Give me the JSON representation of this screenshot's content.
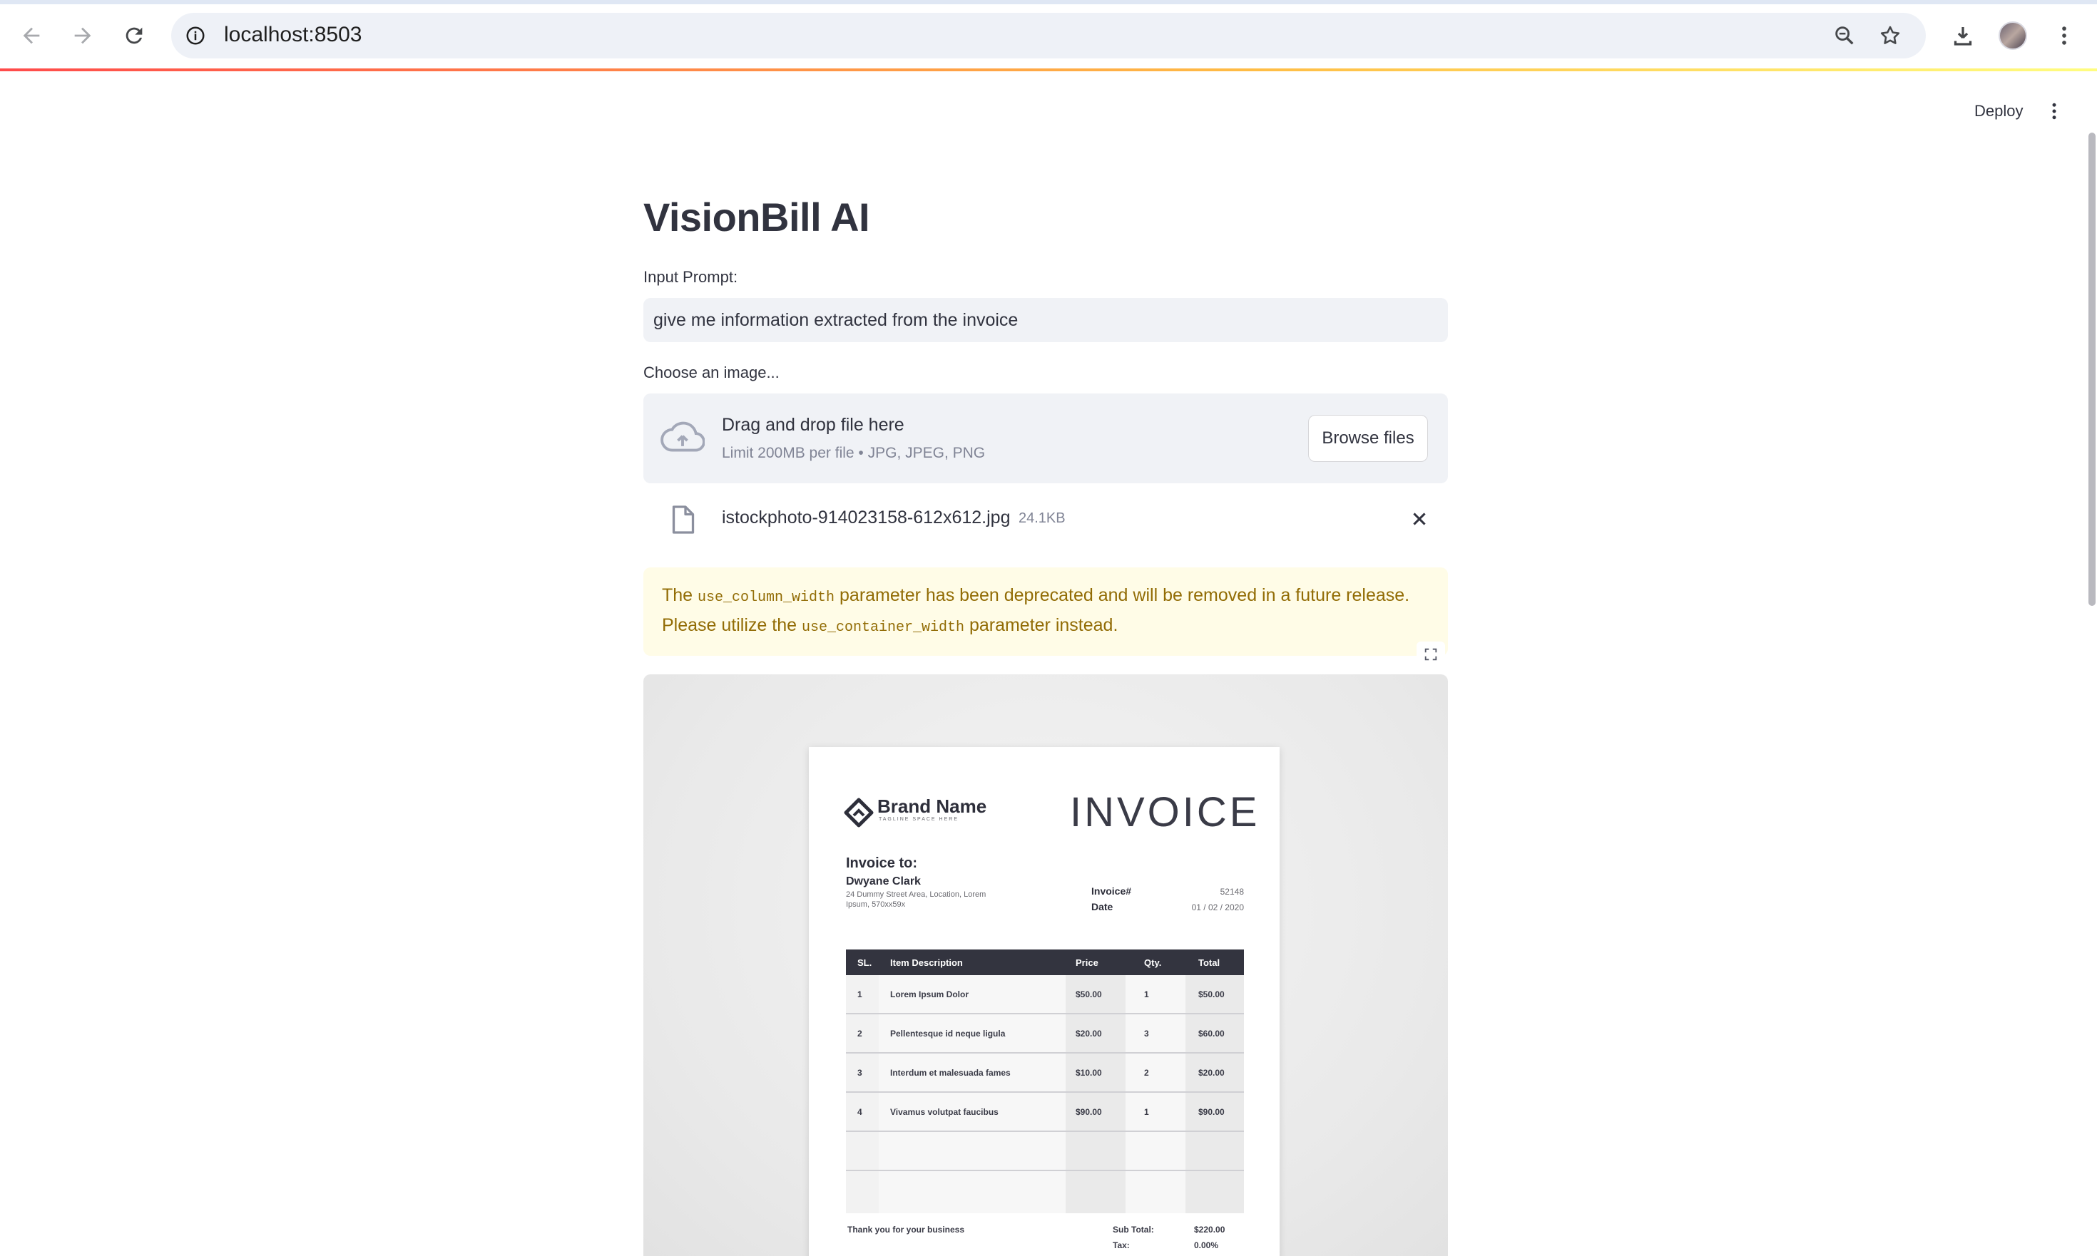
{
  "browser": {
    "url": "localhost:8503"
  },
  "header": {
    "deploy_label": "Deploy"
  },
  "app": {
    "title": "VisionBill AI",
    "prompt_label": "Input Prompt:",
    "prompt_value": "give me information extracted from the invoice",
    "uploader_label": "Choose an image...",
    "dropzone_title": "Drag and drop file here",
    "dropzone_subtitle": "Limit 200MB per file • JPG, JPEG, PNG",
    "browse_label": "Browse files",
    "file": {
      "name": "istockphoto-914023158-612x612.jpg",
      "size": "24.1KB"
    },
    "warning": {
      "part1": "The ",
      "code1": "use_column_width",
      "part2": " parameter has been deprecated and will be removed in a future release. Please utilize the ",
      "code2": "use_container_width",
      "part3": " parameter instead."
    }
  },
  "invoice": {
    "brand_name": "Brand Name",
    "brand_tagline": "TAGLINE SPACE HERE",
    "title": "INVOICE",
    "invoice_to_label": "Invoice to:",
    "client_name": "Dwyane Clark",
    "client_address": "24 Dummy Street Area, Location, Lorem Ipsum, 570xx59x",
    "invoice_no_label": "Invoice#",
    "invoice_no": "52148",
    "date_label": "Date",
    "date": "01 / 02 / 2020",
    "columns": [
      "SL.",
      "Item Description",
      "Price",
      "Qty.",
      "Total"
    ],
    "rows": [
      [
        "1",
        "Lorem Ipsum Dolor",
        "$50.00",
        "1",
        "$50.00"
      ],
      [
        "2",
        "Pellentesque id neque ligula",
        "$20.00",
        "3",
        "$60.00"
      ],
      [
        "3",
        "Interdum et malesuada fames",
        "$10.00",
        "2",
        "$20.00"
      ],
      [
        "4",
        "Vivamus volutpat faucibus",
        "$90.00",
        "1",
        "$90.00"
      ]
    ],
    "thanks": "Thank you for your business",
    "subtotal_label": "Sub Total:",
    "subtotal": "$220.00",
    "tax_label": "Tax:",
    "tax": "0.00%"
  }
}
